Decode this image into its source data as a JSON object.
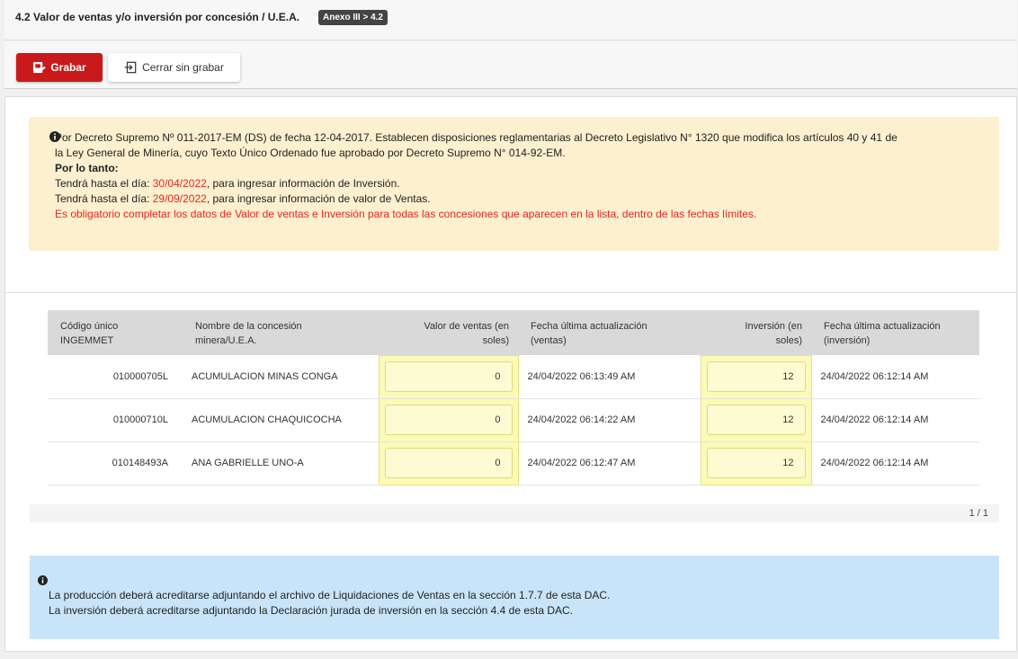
{
  "header": {
    "title": "4.2 Valor de ventas y/o inversión por concesión / U.E.A.",
    "badge": "Anexo III > 4.2"
  },
  "toolbar": {
    "save_label": "Grabar",
    "close_label": "Cerrar sin grabar"
  },
  "notice": {
    "line1": "Por Decreto Supremo Nº 011-2017-EM (DS) de fecha 12-04-2017. Establecen disposiciones reglamentarias al Decreto Legislativo N° 1320 que modifica los artículos 40 y 41 de",
    "line2": "la Ley General de Minería, cuyo Texto Único Ordenado fue aprobado por Decreto Supremo N° 014-92-EM.",
    "por_lo_tanto": "Por lo tanto:",
    "inv_prefix": "Tendrá hasta el día: ",
    "inv_date": "30/04/2022",
    "inv_suffix": ", para ingresar información de Inversión.",
    "ven_prefix": "Tendrá hasta el día: ",
    "ven_date": "29/09/2022",
    "ven_suffix": ", para ingresar información de valor de Ventas.",
    "mandatory": "Es obligatorio completar los datos de Valor de ventas e Inversión para todas las concesiones que aparecen en la lista, dentro de las fechas límites."
  },
  "table": {
    "headers": {
      "codigo_line1": "Código único",
      "codigo_line2": "INGEMMET",
      "nombre_line1": "Nombre de la concesión",
      "nombre_line2": "minera/U.E.A.",
      "ventas_line1": "Valor de ventas (en",
      "ventas_line2": "soles)",
      "fecha_ventas_line1": "Fecha última actualización",
      "fecha_ventas_line2": "(ventas)",
      "inversion_line1": "Inversión (en",
      "inversion_line2": "soles)",
      "fecha_inv_line1": "Fecha última actualización",
      "fecha_inv_line2": "(inversión)"
    },
    "rows": [
      {
        "codigo": "010000705L",
        "nombre": "ACUMULACION MINAS CONGA",
        "ventas": "0",
        "fecha_ventas": "24/04/2022 06:13:49 AM",
        "inversion": "12",
        "fecha_inversion": "24/04/2022 06:12:14 AM"
      },
      {
        "codigo": "010000710L",
        "nombre": "ACUMULACION CHAQUICOCHA",
        "ventas": "0",
        "fecha_ventas": "24/04/2022 06:14:22 AM",
        "inversion": "12",
        "fecha_inversion": "24/04/2022 06:12:14 AM"
      },
      {
        "codigo": "010148493A",
        "nombre": "ANA GABRIELLE UNO-A",
        "ventas": "0",
        "fecha_ventas": "24/04/2022 06:12:47 AM",
        "inversion": "12",
        "fecha_inversion": "24/04/2022 06:12:14 AM"
      }
    ]
  },
  "pager": "1 / 1",
  "info": {
    "line1": "La producción deberá acreditarse adjuntando el archivo de Liquidaciones de Ventas en la sección 1.7.7 de esta DAC.",
    "line2": "La inversión deberá acreditarse adjuntando la Declaración jurada de inversión en la sección 4.4 de esta DAC."
  },
  "colors": {
    "save_button": "#c9191b",
    "deadline_red": "#e8251e",
    "notice_bg": "#fdf0cf",
    "info_bg": "#c9e4f9",
    "input_highlight": "#fbfab8"
  }
}
